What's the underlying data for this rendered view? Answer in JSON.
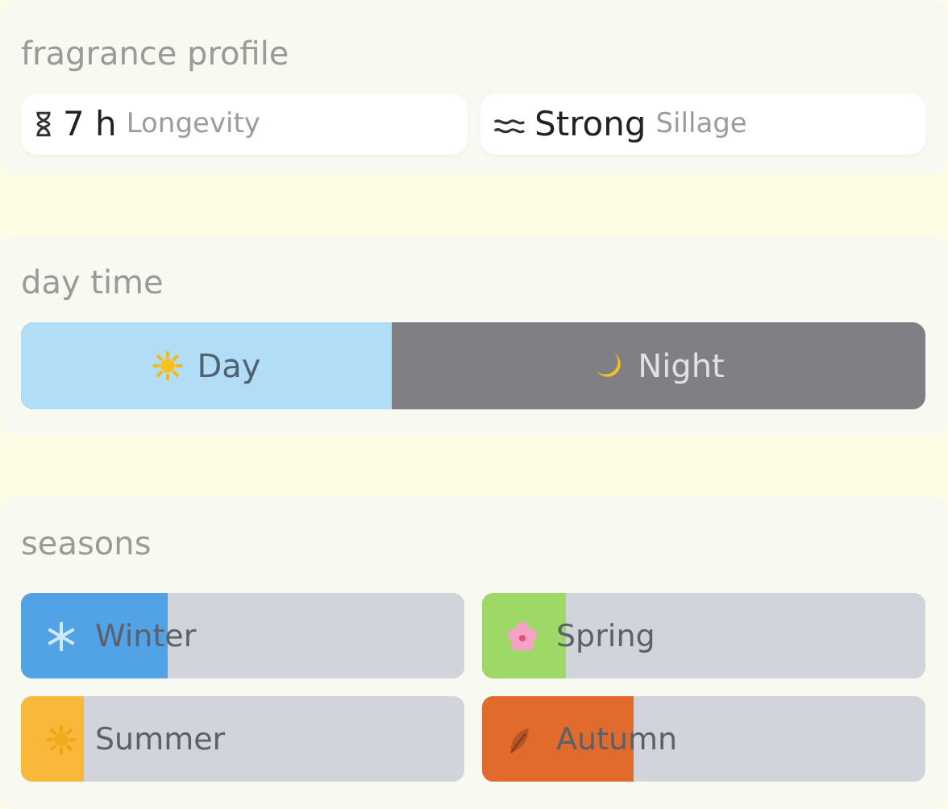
{
  "fragrance_profile": {
    "title": "fragrance profile",
    "stats": [
      {
        "kind": "longevity",
        "value": "7 h",
        "label": "Longevity"
      },
      {
        "kind": "sillage",
        "value": "Strong",
        "label": "Sillage"
      }
    ]
  },
  "day_time": {
    "title": "day time",
    "level": 0.41,
    "segments": [
      {
        "kind": "day",
        "label": "Day"
      },
      {
        "kind": "night",
        "label": "Night"
      }
    ]
  },
  "seasons": {
    "title": "seasons",
    "items": [
      {
        "kind": "winter",
        "label": "Winter",
        "level": 0.33
      },
      {
        "kind": "spring",
        "label": "Spring",
        "level": 0.19
      },
      {
        "kind": "summer",
        "label": "Summer",
        "level": 0.14
      },
      {
        "kind": "autumn",
        "label": "Autumn",
        "level": 0.34
      }
    ]
  }
}
